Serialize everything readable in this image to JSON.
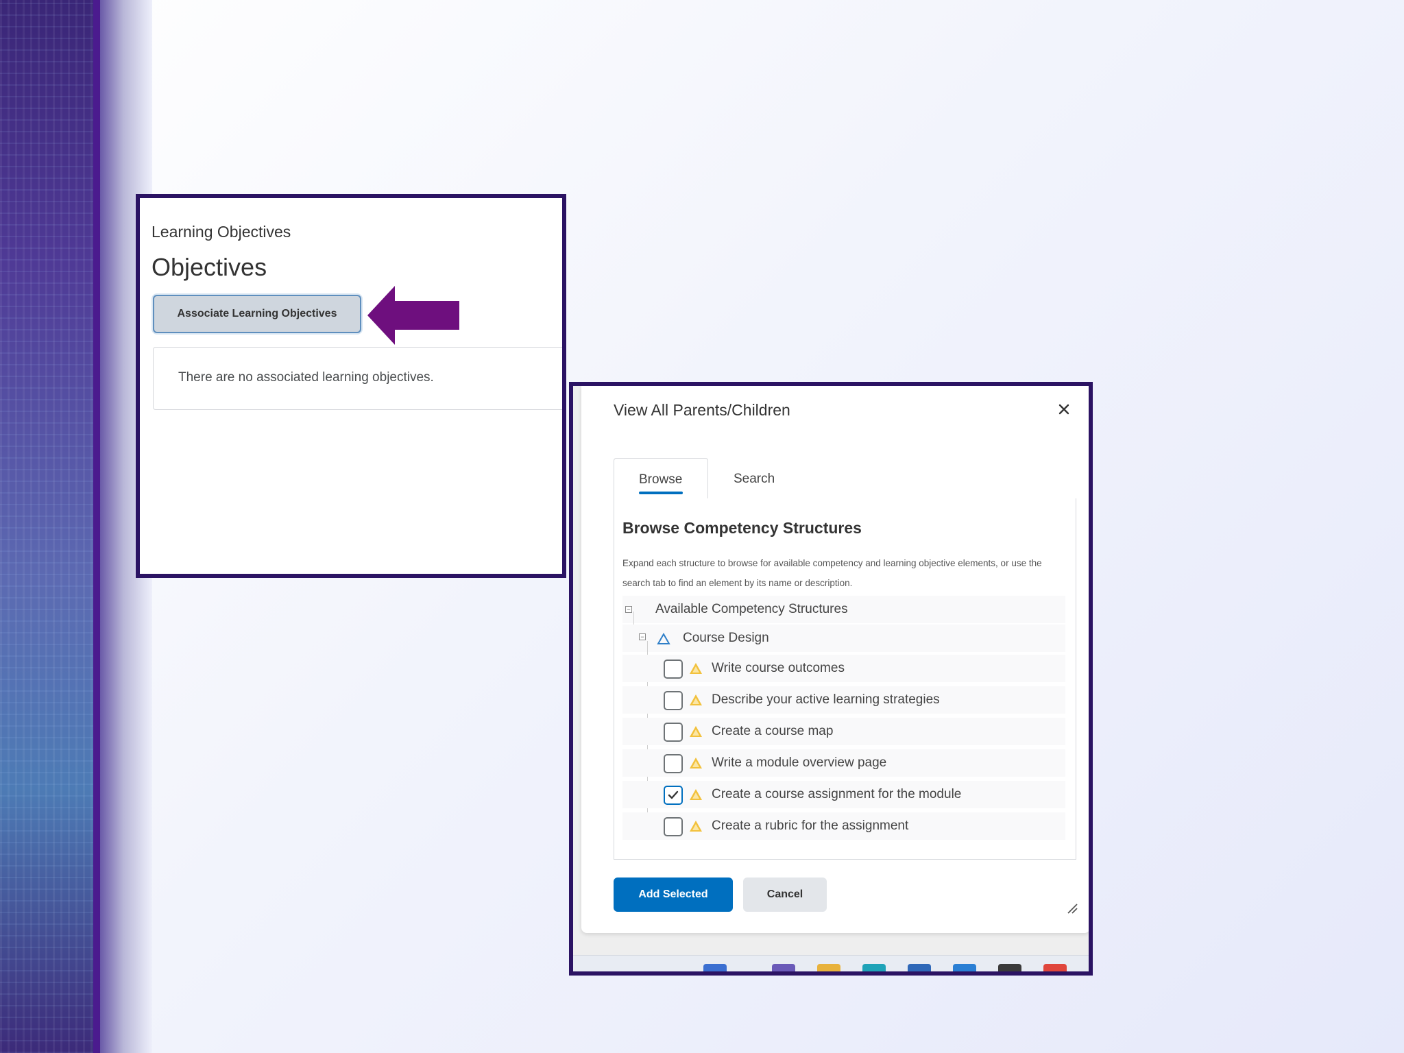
{
  "panel1": {
    "subtitle": "Learning Objectives",
    "title": "Objectives",
    "associate_button": "Associate Learning Objectives",
    "empty_message": "There are no associated learning objectives."
  },
  "dialog": {
    "title": "View All Parents/Children",
    "tabs": {
      "browse": "Browse",
      "search": "Search"
    },
    "heading": "Browse Competency Structures",
    "description": "Expand each structure to browse for available competency and learning objective elements, or use the search tab to find an element by its name or description.",
    "tree": {
      "root_label": "Available Competency Structures",
      "group_label": "Course Design",
      "items": [
        {
          "label": "Write course outcomes",
          "checked": false
        },
        {
          "label": "Describe your active learning strategies",
          "checked": false
        },
        {
          "label": "Create a course map",
          "checked": false
        },
        {
          "label": "Write a module overview page",
          "checked": false
        },
        {
          "label": "Create a course assignment for the module",
          "checked": true
        },
        {
          "label": "Create a rubric for the assignment",
          "checked": false
        }
      ]
    },
    "add_button": "Add Selected",
    "cancel_button": "Cancel"
  },
  "colors": {
    "frame": "#2b1363",
    "arrow": "#6e0f7e",
    "primary": "#006fbf"
  }
}
